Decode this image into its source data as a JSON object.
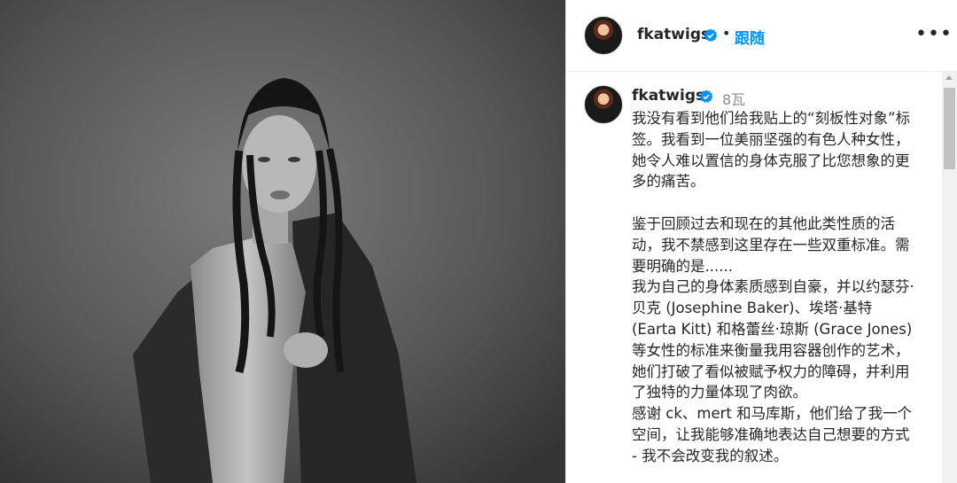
{
  "post": {
    "image_alt": "Black-and-white portrait photograph"
  },
  "header": {
    "username": "fkatwigs",
    "separator": "•",
    "follow_label": "跟随",
    "more_icon": "more-horizontal-icon"
  },
  "comment": {
    "username": "fkatwigs",
    "time": "8瓦",
    "paragraphs": [
      "我没有看到他们给我贴上的“刻板性对象”标签。我看到一位美丽坚强的有色人种女性，她令人难以置信的身体克服了比您想象的更多的痛苦。",
      "鉴于回顾过去和现在的其他此类性质的活动，我不禁感到这里存在一些双重标准。需要明确的是......",
      "我为自己的身体素质感到自豪，并以约瑟芬·贝克 (Josephine Baker)、埃塔·基特 (Earta Kitt) 和格蕾丝·琼斯 (Grace Jones) 等女性的标准来衡量我用容器创作的艺术，她们打破了看似被赋予权力的障碍，并利用了独特的力量体现了肉欲。",
      "感谢 ck、mert 和马库斯，他们给了我一个空间，让我能够准确地表达自己想要的方式 - 我不会改变我的叙述。"
    ]
  },
  "colors": {
    "link_blue": "#0095f6",
    "text": "#262626",
    "muted": "#8e8e8e"
  }
}
